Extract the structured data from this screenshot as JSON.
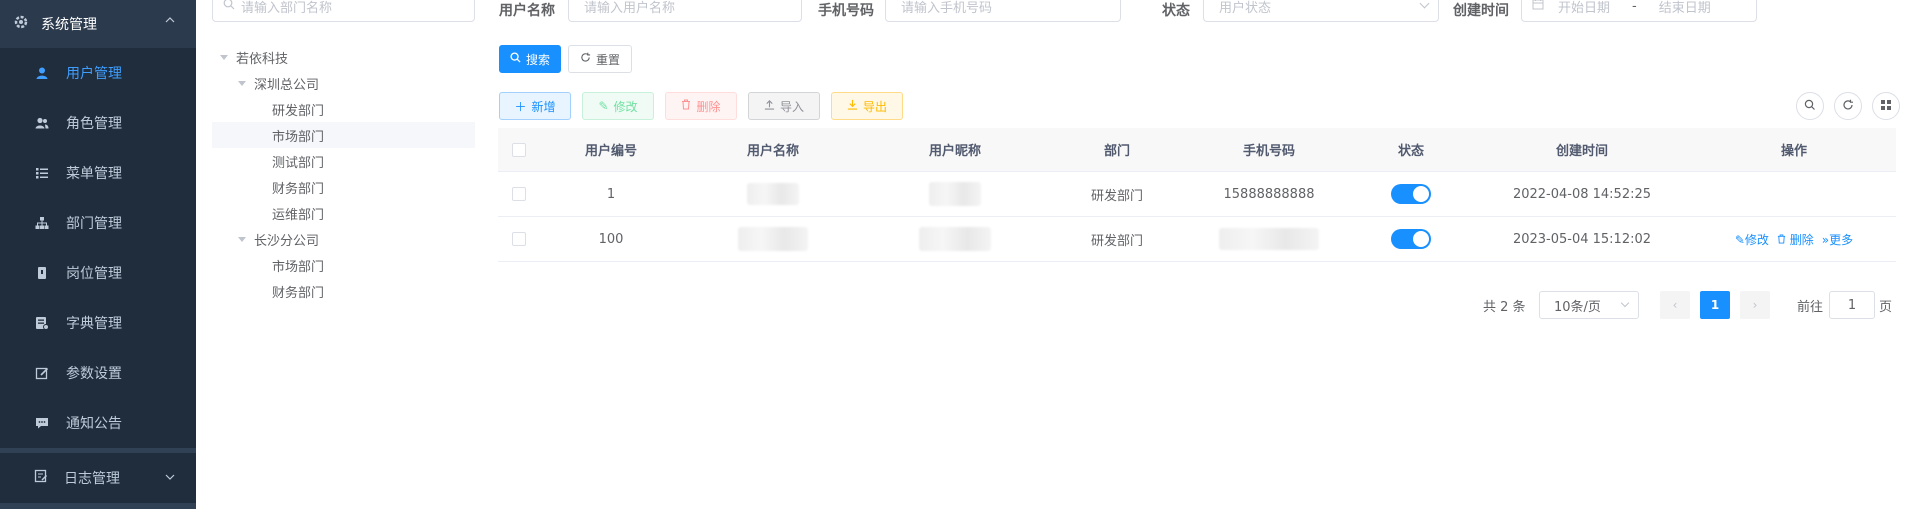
{
  "sidebar": {
    "group": {
      "label": "系统管理",
      "icon": "gear-icon"
    },
    "items": [
      {
        "label": "用户管理",
        "icon": "user-icon",
        "active": true
      },
      {
        "label": "角色管理",
        "icon": "users-icon"
      },
      {
        "label": "菜单管理",
        "icon": "list-icon"
      },
      {
        "label": "部门管理",
        "icon": "tree-icon"
      },
      {
        "label": "岗位管理",
        "icon": "post-icon"
      },
      {
        "label": "字典管理",
        "icon": "dict-icon"
      },
      {
        "label": "参数设置",
        "icon": "edit-icon"
      },
      {
        "label": "通知公告",
        "icon": "message-icon"
      }
    ],
    "bottom": {
      "label": "日志管理",
      "icon": "log-icon"
    }
  },
  "tree": {
    "search_placeholder": "请输入部门名称",
    "nodes": [
      {
        "label": "若依科技"
      },
      {
        "label": "深圳总公司"
      },
      {
        "label": "研发部门"
      },
      {
        "label": "市场部门"
      },
      {
        "label": "测试部门"
      },
      {
        "label": "财务部门"
      },
      {
        "label": "运维部门"
      },
      {
        "label": "长沙分公司"
      },
      {
        "label": "市场部门"
      },
      {
        "label": "财务部门"
      }
    ]
  },
  "filters": {
    "username_label": "用户名称",
    "username_placeholder": "请输入用户名称",
    "phone_label": "手机号码",
    "phone_placeholder": "请输入手机号码",
    "status_label": "状态",
    "status_placeholder": "用户状态",
    "created_label": "创建时间",
    "start_placeholder": "开始日期",
    "range_sep": "-",
    "end_placeholder": "结束日期"
  },
  "actions": {
    "search": "搜索",
    "reset": "重置",
    "add": "新增",
    "edit": "修改",
    "delete": "删除",
    "import": "导入",
    "export": "导出"
  },
  "table": {
    "headers": [
      "用户编号",
      "用户名称",
      "用户昵称",
      "部门",
      "手机号码",
      "状态",
      "创建时间",
      "操作"
    ],
    "rows": [
      {
        "id": "1",
        "dept": "研发部门",
        "phone": "15888888888",
        "status_on": true,
        "created": "2022-04-08 14:52:25",
        "ops": []
      },
      {
        "id": "100",
        "dept": "研发部门",
        "phone": "",
        "status_on": true,
        "created": "2023-05-04 15:12:02",
        "ops": [
          "修改",
          "删除",
          "更多"
        ]
      }
    ]
  },
  "pagination": {
    "total": "共 2 条",
    "page_size": "10条/页",
    "current": "1",
    "goto_prefix": "前往",
    "goto_value": "1",
    "goto_suffix": "页"
  }
}
